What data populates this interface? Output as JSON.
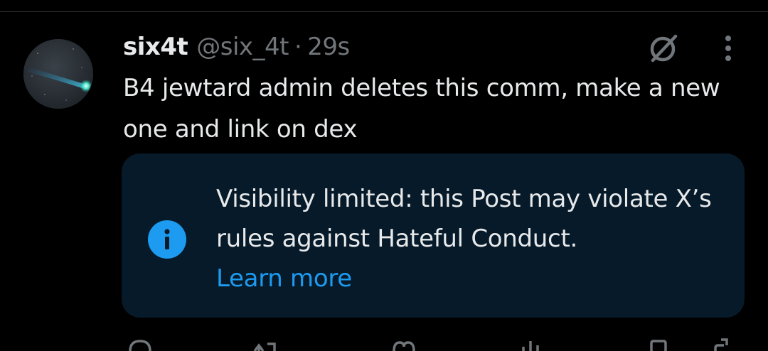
{
  "post": {
    "author_name": "six4t",
    "author_handle": "@six_4t",
    "separator": "·",
    "timestamp": "29s",
    "text": "B4 jewtard admin deletes this comm, make a new one and link on dex",
    "avatar_icon": "comet-avatar"
  },
  "notice": {
    "icon": "info-icon",
    "message": "Visibility limited: this Post may violate X’s rules against Hateful Conduct.",
    "link_label": "Learn more",
    "link_color": "#1d9bf0",
    "background_color": "#061a29"
  },
  "header_icons": {
    "grok": "grok-icon",
    "more": "more-icon"
  },
  "actions": [
    "reply-icon",
    "repost-icon",
    "like-icon",
    "views-icon",
    "bookmark-icon",
    "share-icon"
  ],
  "colors": {
    "background": "#000000",
    "text_primary": "#e7e9ea",
    "text_secondary": "#71767b",
    "accent": "#1d9bf0"
  }
}
